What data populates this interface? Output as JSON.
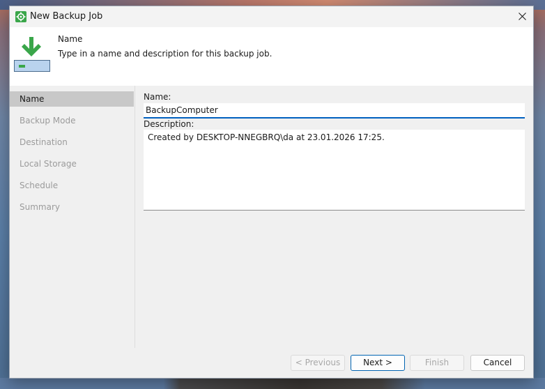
{
  "window": {
    "title": "New Backup Job"
  },
  "header": {
    "title": "Name",
    "description": "Type in a name and description for this backup job."
  },
  "nav": {
    "items": [
      {
        "label": "Name",
        "active": true
      },
      {
        "label": "Backup Mode",
        "active": false
      },
      {
        "label": "Destination",
        "active": false
      },
      {
        "label": "Local Storage",
        "active": false
      },
      {
        "label": "Schedule",
        "active": false
      },
      {
        "label": "Summary",
        "active": false
      }
    ]
  },
  "form": {
    "name_label": "Name:",
    "name_value": "BackupComputer",
    "description_label": "Description:",
    "description_value": "Created by DESKTOP-NNEGBRQ\\da at 23.01.2026 17:25."
  },
  "buttons": {
    "previous": "< Previous",
    "next": "Next >",
    "finish": "Finish",
    "cancel": "Cancel"
  },
  "colors": {
    "accent": "#0060c0",
    "brand_green": "#3aa64a",
    "nav_active_bg": "#c8c8c8"
  }
}
